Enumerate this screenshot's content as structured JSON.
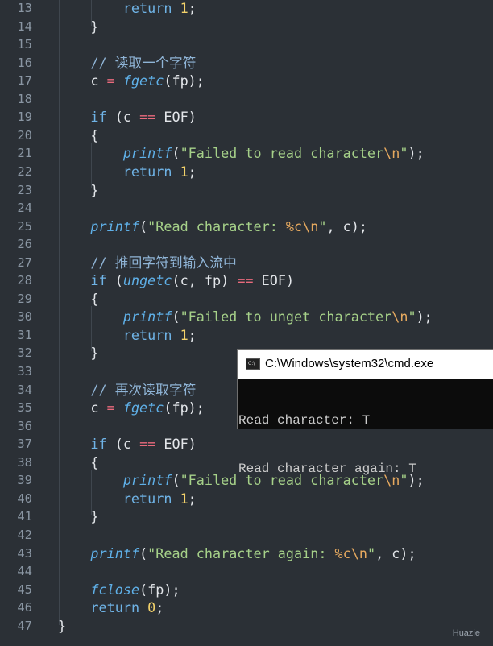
{
  "editor": {
    "lines": [
      {
        "n": "13",
        "t": [
          [
            "        ",
            ""
          ],
          [
            "return",
            "kw"
          ],
          [
            " ",
            ""
          ],
          [
            "1",
            "num"
          ],
          [
            ";",
            ""
          ]
        ]
      },
      {
        "n": "14",
        "t": [
          [
            "    }",
            ""
          ]
        ]
      },
      {
        "n": "15",
        "t": []
      },
      {
        "n": "16",
        "t": [
          [
            "    // 读取一个字符",
            "cm"
          ]
        ]
      },
      {
        "n": "17",
        "t": [
          [
            "    c ",
            ""
          ],
          [
            "=",
            "op"
          ],
          [
            " ",
            ""
          ],
          [
            "fgetc",
            "fn"
          ],
          [
            "(fp);",
            ""
          ]
        ]
      },
      {
        "n": "18",
        "t": []
      },
      {
        "n": "19",
        "t": [
          [
            "    ",
            ""
          ],
          [
            "if",
            "kw"
          ],
          [
            " (c ",
            ""
          ],
          [
            "==",
            "op"
          ],
          [
            " EOF)",
            ""
          ]
        ]
      },
      {
        "n": "20",
        "t": [
          [
            "    {",
            ""
          ]
        ]
      },
      {
        "n": "21",
        "t": [
          [
            "        ",
            ""
          ],
          [
            "printf",
            "fn"
          ],
          [
            "(",
            ""
          ],
          [
            "\"Failed to read character",
            "str"
          ],
          [
            "\\n",
            "esc"
          ],
          [
            "\"",
            "str"
          ],
          [
            ");",
            ""
          ]
        ]
      },
      {
        "n": "22",
        "t": [
          [
            "        ",
            ""
          ],
          [
            "return",
            "kw"
          ],
          [
            " ",
            ""
          ],
          [
            "1",
            "num"
          ],
          [
            ";",
            ""
          ]
        ]
      },
      {
        "n": "23",
        "t": [
          [
            "    }",
            ""
          ]
        ]
      },
      {
        "n": "24",
        "t": []
      },
      {
        "n": "25",
        "t": [
          [
            "    ",
            ""
          ],
          [
            "printf",
            "fn"
          ],
          [
            "(",
            ""
          ],
          [
            "\"Read character: ",
            "str"
          ],
          [
            "%c",
            "esc"
          ],
          [
            "\\n",
            "esc"
          ],
          [
            "\"",
            "str"
          ],
          [
            ", c);",
            ""
          ]
        ]
      },
      {
        "n": "26",
        "t": []
      },
      {
        "n": "27",
        "t": [
          [
            "    // 推回字符到输入流中",
            "cm"
          ]
        ]
      },
      {
        "n": "28",
        "t": [
          [
            "    ",
            ""
          ],
          [
            "if",
            "kw"
          ],
          [
            " (",
            ""
          ],
          [
            "ungetc",
            "fn"
          ],
          [
            "(c, fp) ",
            ""
          ],
          [
            "==",
            "op"
          ],
          [
            " EOF)",
            ""
          ]
        ]
      },
      {
        "n": "29",
        "t": [
          [
            "    {",
            ""
          ]
        ]
      },
      {
        "n": "30",
        "t": [
          [
            "        ",
            ""
          ],
          [
            "printf",
            "fn"
          ],
          [
            "(",
            ""
          ],
          [
            "\"Failed to unget character",
            "str"
          ],
          [
            "\\n",
            "esc"
          ],
          [
            "\"",
            "str"
          ],
          [
            ");",
            ""
          ]
        ]
      },
      {
        "n": "31",
        "t": [
          [
            "        ",
            ""
          ],
          [
            "return",
            "kw"
          ],
          [
            " ",
            ""
          ],
          [
            "1",
            "num"
          ],
          [
            ";",
            ""
          ]
        ]
      },
      {
        "n": "32",
        "t": [
          [
            "    }",
            ""
          ]
        ]
      },
      {
        "n": "33",
        "t": []
      },
      {
        "n": "34",
        "t": [
          [
            "    // 再次读取字符",
            "cm"
          ]
        ]
      },
      {
        "n": "35",
        "t": [
          [
            "    c ",
            ""
          ],
          [
            "=",
            "op"
          ],
          [
            " ",
            ""
          ],
          [
            "fgetc",
            "fn"
          ],
          [
            "(fp);",
            ""
          ]
        ]
      },
      {
        "n": "36",
        "t": []
      },
      {
        "n": "37",
        "t": [
          [
            "    ",
            ""
          ],
          [
            "if",
            "kw"
          ],
          [
            " (c ",
            ""
          ],
          [
            "==",
            "op"
          ],
          [
            " EOF)",
            ""
          ]
        ]
      },
      {
        "n": "38",
        "t": [
          [
            "    {",
            ""
          ]
        ]
      },
      {
        "n": "39",
        "t": [
          [
            "        ",
            ""
          ],
          [
            "printf",
            "fn"
          ],
          [
            "(",
            ""
          ],
          [
            "\"Failed to read character",
            "str"
          ],
          [
            "\\n",
            "esc"
          ],
          [
            "\"",
            "str"
          ],
          [
            ");",
            ""
          ]
        ]
      },
      {
        "n": "40",
        "t": [
          [
            "        ",
            ""
          ],
          [
            "return",
            "kw"
          ],
          [
            " ",
            ""
          ],
          [
            "1",
            "num"
          ],
          [
            ";",
            ""
          ]
        ]
      },
      {
        "n": "41",
        "t": [
          [
            "    }",
            ""
          ]
        ]
      },
      {
        "n": "42",
        "t": []
      },
      {
        "n": "43",
        "t": [
          [
            "    ",
            ""
          ],
          [
            "printf",
            "fn"
          ],
          [
            "(",
            ""
          ],
          [
            "\"Read character again: ",
            "str"
          ],
          [
            "%c",
            "esc"
          ],
          [
            "\\n",
            "esc"
          ],
          [
            "\"",
            "str"
          ],
          [
            ", c);",
            ""
          ]
        ]
      },
      {
        "n": "44",
        "t": []
      },
      {
        "n": "45",
        "t": [
          [
            "    ",
            ""
          ],
          [
            "fclose",
            "fn"
          ],
          [
            "(fp);",
            ""
          ]
        ]
      },
      {
        "n": "46",
        "t": [
          [
            "    ",
            ""
          ],
          [
            "return",
            "kw"
          ],
          [
            " ",
            ""
          ],
          [
            "0",
            "num"
          ],
          [
            ";",
            ""
          ]
        ]
      },
      {
        "n": "47",
        "t": [
          [
            "}",
            ""
          ]
        ]
      }
    ]
  },
  "console": {
    "title": "C:\\Windows\\system32\\cmd.exe",
    "icon": "console-app-icon",
    "icon_text": "C:\\",
    "output": [
      "Read character: T",
      "Read character again: T"
    ]
  },
  "watermark": "Huazie"
}
